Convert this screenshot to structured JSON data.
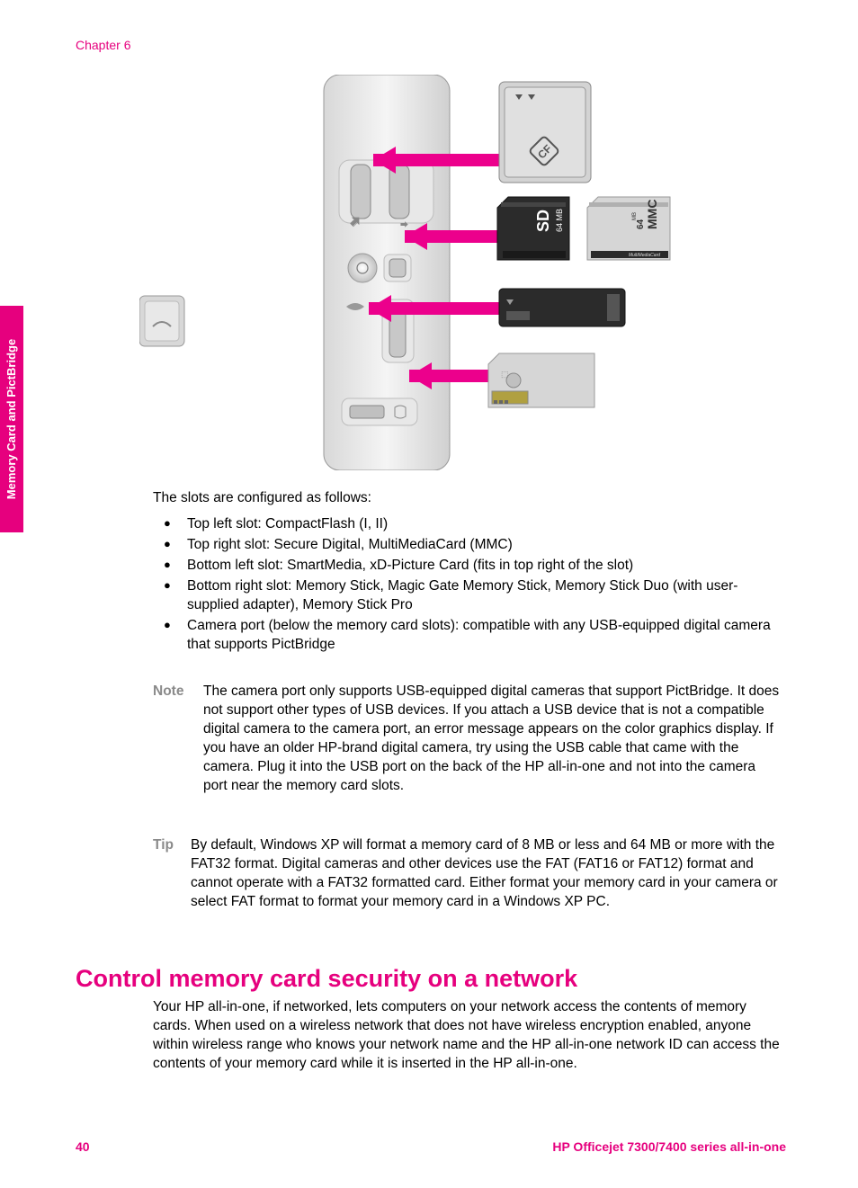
{
  "header": {
    "chapter": "Chapter 6"
  },
  "sideTab": {
    "label": "Memory Card and PictBridge"
  },
  "figure": {
    "cards": {
      "cf": "CF",
      "sd": "SD",
      "sd_cap": "64 MB",
      "mmc": "MMC",
      "mmc_cap": "64 MB",
      "mmc_sub": "MultiMediaCard"
    }
  },
  "intro": "The slots are configured as follows:",
  "bullets": [
    "Top left slot: CompactFlash (I, II)",
    "Top right slot: Secure Digital, MultiMediaCard (MMC)",
    "Bottom left slot: SmartMedia, xD-Picture Card (fits in top right of the slot)",
    "Bottom right slot: Memory Stick, Magic Gate Memory Stick, Memory Stick Duo (with user-supplied adapter), Memory Stick Pro",
    "Camera port (below the memory card slots): compatible with any USB-equipped digital camera that supports PictBridge"
  ],
  "note": {
    "label": "Note",
    "text": "The camera port only supports USB-equipped digital cameras that support PictBridge. It does not support other types of USB devices. If you attach a USB device that is not a compatible digital camera to the camera port, an error message appears on the color graphics display. If you have an older HP-brand digital camera, try using the USB cable that came with the camera. Plug it into the USB port on the back of the HP all-in-one and not into the camera port near the memory card slots."
  },
  "tip": {
    "label": "Tip",
    "text": "By default, Windows XP will format a memory card of 8 MB or less and 64 MB or more with the FAT32 format. Digital cameras and other devices use the FAT (FAT16 or FAT12) format and cannot operate with a FAT32 formatted card. Either format your memory card in your camera or select FAT format to format your memory card in a Windows XP PC."
  },
  "section": {
    "heading": "Control memory card security on a network",
    "body": "Your HP all-in-one, if networked, lets computers on your network access the contents of memory cards. When used on a wireless network that does not have wireless encryption enabled, anyone within wireless range who knows your network name and the HP all-in-one network ID can access the contents of your memory card while it is inserted in the HP all-in-one."
  },
  "footer": {
    "page": "40",
    "product": "HP Officejet 7300/7400 series all-in-one"
  }
}
